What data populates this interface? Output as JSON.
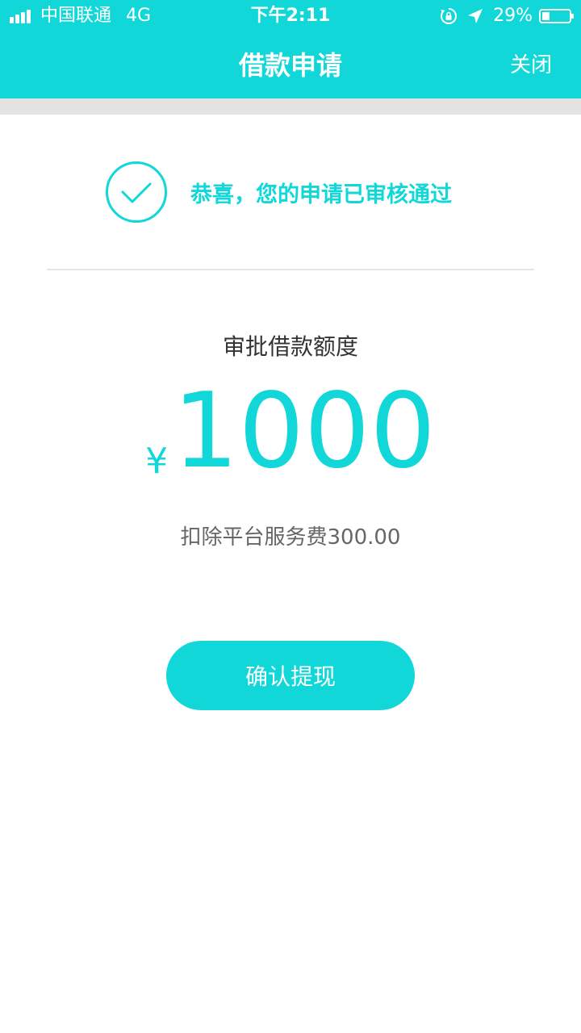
{
  "status_bar": {
    "carrier": "中国联通",
    "network": "4G",
    "time": "下午2:11",
    "battery": "29%"
  },
  "nav": {
    "title": "借款申请",
    "close_label": "关闭"
  },
  "success": {
    "message": "恭喜，您的申请已审核通过"
  },
  "amount": {
    "label": "审批借款额度",
    "currency": "¥",
    "value": "1000",
    "fee_text": "扣除平台服务费300.00"
  },
  "actions": {
    "confirm_label": "确认提现"
  },
  "colors": {
    "accent": "#12d7d9",
    "band": "#e3e3e3"
  }
}
